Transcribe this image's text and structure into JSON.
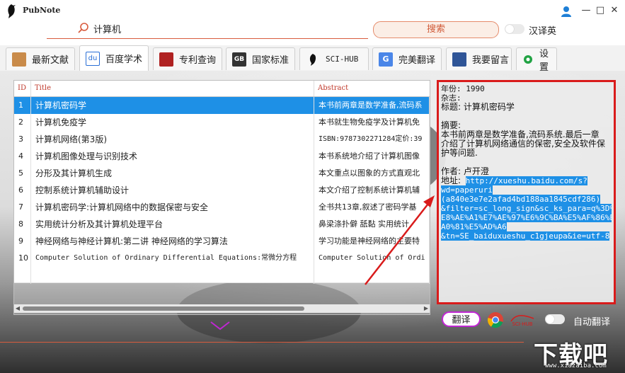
{
  "app": {
    "name": "PubNote",
    "window_controls": [
      "—",
      "□",
      "✕"
    ]
  },
  "search": {
    "query": "计算机",
    "placeholder": "",
    "button_label": "搜索",
    "toggle_label": "汉译英",
    "toggle_on": false
  },
  "tabs": [
    {
      "label": "最新文献",
      "icon": "book-cat-icon",
      "active": false
    },
    {
      "label": "百度学术",
      "icon": "baidu-paw-icon",
      "active": true
    },
    {
      "label": "专利查询",
      "icon": "patent-icon",
      "active": false
    },
    {
      "label": "国家标准",
      "icon": "gb-standard-icon",
      "active": false
    },
    {
      "label": "SCI-HUB",
      "icon": "raven-icon",
      "active": false
    },
    {
      "label": "完美翻译",
      "icon": "google-translate-icon",
      "active": false
    },
    {
      "label": "我要留言",
      "icon": "message-icon",
      "active": false
    },
    {
      "label": "设置",
      "icon": "gear-icon",
      "active": false
    }
  ],
  "table": {
    "columns": [
      "ID",
      "Title",
      "Abstract"
    ],
    "selected_row": 0,
    "rows": [
      {
        "id": "1",
        "title": "计算机密码学",
        "abstract": "本书前两章是数学准备,流码系"
      },
      {
        "id": "2",
        "title": "计算机免疫学",
        "abstract": "本书就生物免疫学及计算机免"
      },
      {
        "id": "3",
        "title": "计算机网络(第3版)",
        "abstract": "ISBN:9787302271284定价:39"
      },
      {
        "id": "4",
        "title": "计算机图像处理与识别技术",
        "abstract": "本书系统地介绍了计算机图像"
      },
      {
        "id": "5",
        "title": "分形及其计算机生成",
        "abstract": "本文重点以图象的方式直观北"
      },
      {
        "id": "6",
        "title": "控制系统计算机辅助设计",
        "abstract": "本文介绍了控制系统计算机辅"
      },
      {
        "id": "7",
        "title": "计算机密码学:计算机网络中的数据保密与安全",
        "abstract": "全书共13章,叙述了密码学基"
      },
      {
        "id": "8",
        "title": "实用统计分析及其计算机处理平台",
        "abstract": "鼻梁涤扑僻   舐黏 实用统计"
      },
      {
        "id": "9",
        "title": "神经网络与神经计算机:第二讲 神经网络的学习算法",
        "abstract": "学习功能是神经网络的主要特"
      },
      {
        "id": "10",
        "title": "Computer Solution of Ordinary Differential Equations:常微分方程",
        "abstract": "Computer Solution of Ordi"
      }
    ]
  },
  "detail": {
    "year_line": "年份: 1990",
    "journal_line": "杂志:",
    "title_line": "标题: 计算机密码学",
    "abstract_head": "摘要:",
    "abstract_lines": [
      "本书前两章是数学准备,流码系统.最后一章",
      "介绍了计算机网络通信的保密,安全及软件保",
      "护等问题."
    ],
    "author_line": "作者: 卢开澄",
    "url_label": "地址:",
    "url_lines": [
      "http://xueshu.baidu.com/s?",
      "wd=paperuri",
      "(a840e3e7e2afad4bd188aa1845cdf286)",
      "&filter=sc_long_sign&sc_ks_para=q%3D%",
      "E8%AE%A1%E7%AE%97%E6%9C%BA%E5%AF%86%E7%",
      "A0%81%E5%AD%A6",
      "&tn=SE_baiduxueshu_c1gjeupa&ie=utf-8"
    ]
  },
  "footer": {
    "translate_label": "翻译",
    "baidu_label": "SCI-HUB",
    "auto_translate_label": "自动翻译",
    "auto_translate_on": false
  },
  "watermark": {
    "text": "下载吧",
    "url": "www.xiazaiba.com"
  },
  "colors": {
    "accent": "#d85c3e",
    "selection": "#1e90e6",
    "detail_border": "#d91b1b",
    "translate_border": "#c026d3"
  }
}
